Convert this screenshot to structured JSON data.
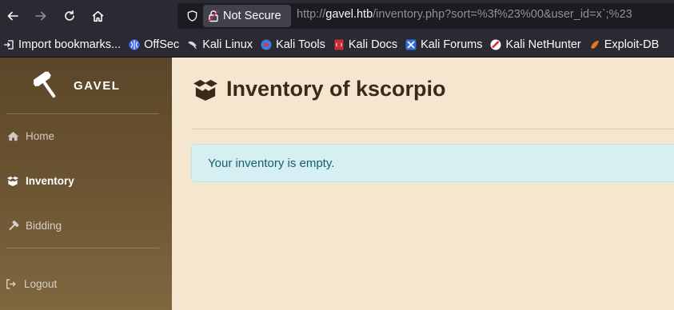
{
  "browser": {
    "security_label": "Not Secure",
    "url_scheme": "http://",
    "url_host": "gavel.htb",
    "url_path": "/inventory.php?sort=%3f%23%00&user_id=x`;%23"
  },
  "bookmarks": [
    {
      "label": "Import bookmarks...",
      "icon": "import-icon"
    },
    {
      "label": "OffSec",
      "icon": "offsec-icon"
    },
    {
      "label": "Kali Linux",
      "icon": "kali-dragon-icon"
    },
    {
      "label": "Kali Tools",
      "icon": "kali-tools-icon"
    },
    {
      "label": "Kali Docs",
      "icon": "kali-docs-icon"
    },
    {
      "label": "Kali Forums",
      "icon": "kali-forums-icon"
    },
    {
      "label": "Kali NetHunter",
      "icon": "kali-nethunter-icon"
    },
    {
      "label": "Exploit-DB",
      "icon": "exploit-db-icon"
    }
  ],
  "sidebar": {
    "brand": "GAVEL",
    "items": [
      {
        "label": "Home",
        "icon": "home-icon",
        "active": false
      },
      {
        "label": "Inventory",
        "icon": "box-open-icon",
        "active": true
      },
      {
        "label": "Bidding",
        "icon": "hammer-icon",
        "active": false
      },
      {
        "label": "Logout",
        "icon": "logout-icon",
        "active": false
      }
    ]
  },
  "main": {
    "title": "Inventory of kscorpio",
    "title_icon": "box-open-icon",
    "message": "Your inventory is empty."
  },
  "colors": {
    "sidebar_top": "#5b4629",
    "sidebar_bottom": "#7f6740",
    "content_bg": "#f5e6d0",
    "alert_bg": "#d6eff2",
    "alert_text": "#155e6e"
  }
}
